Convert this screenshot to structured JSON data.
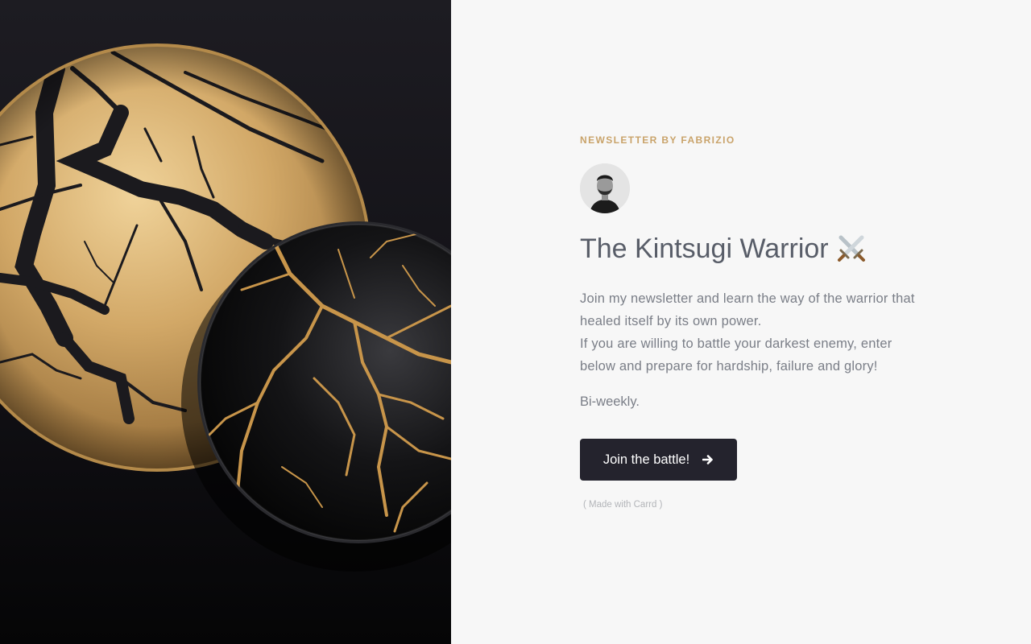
{
  "hero": {
    "image_icon": "kintsugi-plates-image"
  },
  "newsletter": {
    "eyebrow": "NEWSLETTER BY FABRIZIO",
    "title": "The Kintsugi Warrior",
    "title_emoji_icon": "crossed-swords-icon",
    "description": [
      "Join my newsletter and learn the way of the warrior that healed itself by its own power.",
      "If you are willing to battle your darkest enemy, enter below and prepare for hardship, failure and glory!"
    ],
    "cadence": "Bi-weekly.",
    "cta_label": "Join the battle!",
    "cta_icon": "arrow-right-icon",
    "credit": "( Made with Carrd )"
  },
  "colors": {
    "accent": "#c9a36a",
    "button_bg": "#24232d",
    "title": "#585d68",
    "text": "#7a7e87",
    "page_bg": "#f7f7f7"
  }
}
